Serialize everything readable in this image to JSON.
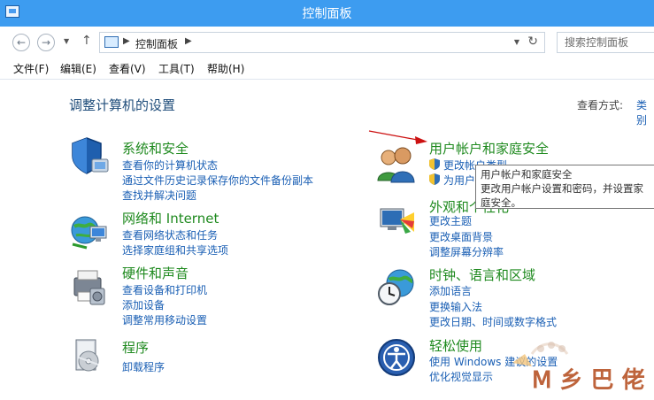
{
  "window": {
    "title": "控制面板"
  },
  "nav": {
    "back": "←",
    "forward": "→",
    "up": "↑",
    "breadcrumb": "控制面板",
    "search_placeholder": "搜索控制面板"
  },
  "menu": [
    "文件(F)",
    "编辑(E)",
    "查看(V)",
    "工具(T)",
    "帮助(H)"
  ],
  "main": {
    "heading": "调整计算机的设置",
    "view_by_label": "查看方式:",
    "view_by_value": "类别"
  },
  "categories": [
    {
      "icon": "shield-icon",
      "title": "系统和安全",
      "links": [
        "查看你的计算机状态",
        "通过文件历史记录保存你的文件备份副本",
        "查找并解决问题"
      ]
    },
    {
      "icon": "network-globe-icon",
      "title": "网络和 Internet",
      "links": [
        "查看网络状态和任务",
        "选择家庭组和共享选项"
      ]
    },
    {
      "icon": "printer-icon",
      "title": "硬件和声音",
      "links": [
        "查看设备和打印机",
        "添加设备",
        "调整常用移动设置"
      ]
    },
    {
      "icon": "program-box-icon",
      "title": "程序",
      "links": [
        "卸载程序"
      ]
    },
    {
      "icon": "users-icon",
      "title": "用户帐户和家庭安全",
      "links": [
        "更改帐户类型",
        "为用户设置家庭安全"
      ]
    },
    {
      "icon": "paint-palette-icon",
      "title": "外观和个性化",
      "links": [
        "更改主题",
        "更改桌面背景",
        "调整屏幕分辨率"
      ]
    },
    {
      "icon": "clock-globe-icon",
      "title": "时钟、语言和区域",
      "links": [
        "添加语言",
        "更换输入法",
        "更改日期、时间或数字格式"
      ]
    },
    {
      "icon": "ease-of-access-icon",
      "title": "轻松使用",
      "links": [
        "使用 Windows 建议的设置",
        "优化视觉显示"
      ]
    }
  ],
  "tooltip": {
    "line1": "用户帐户和家庭安全",
    "line2": "更改用户帐户设置和密码，并设置家",
    "line3": "庭安全。"
  },
  "colors": {
    "titlebar": "#3d9cf0",
    "category_title": "#1f8a1f",
    "link": "#1a5fb4",
    "heading": "#1e4c7a",
    "arrow": "#cc1111"
  }
}
